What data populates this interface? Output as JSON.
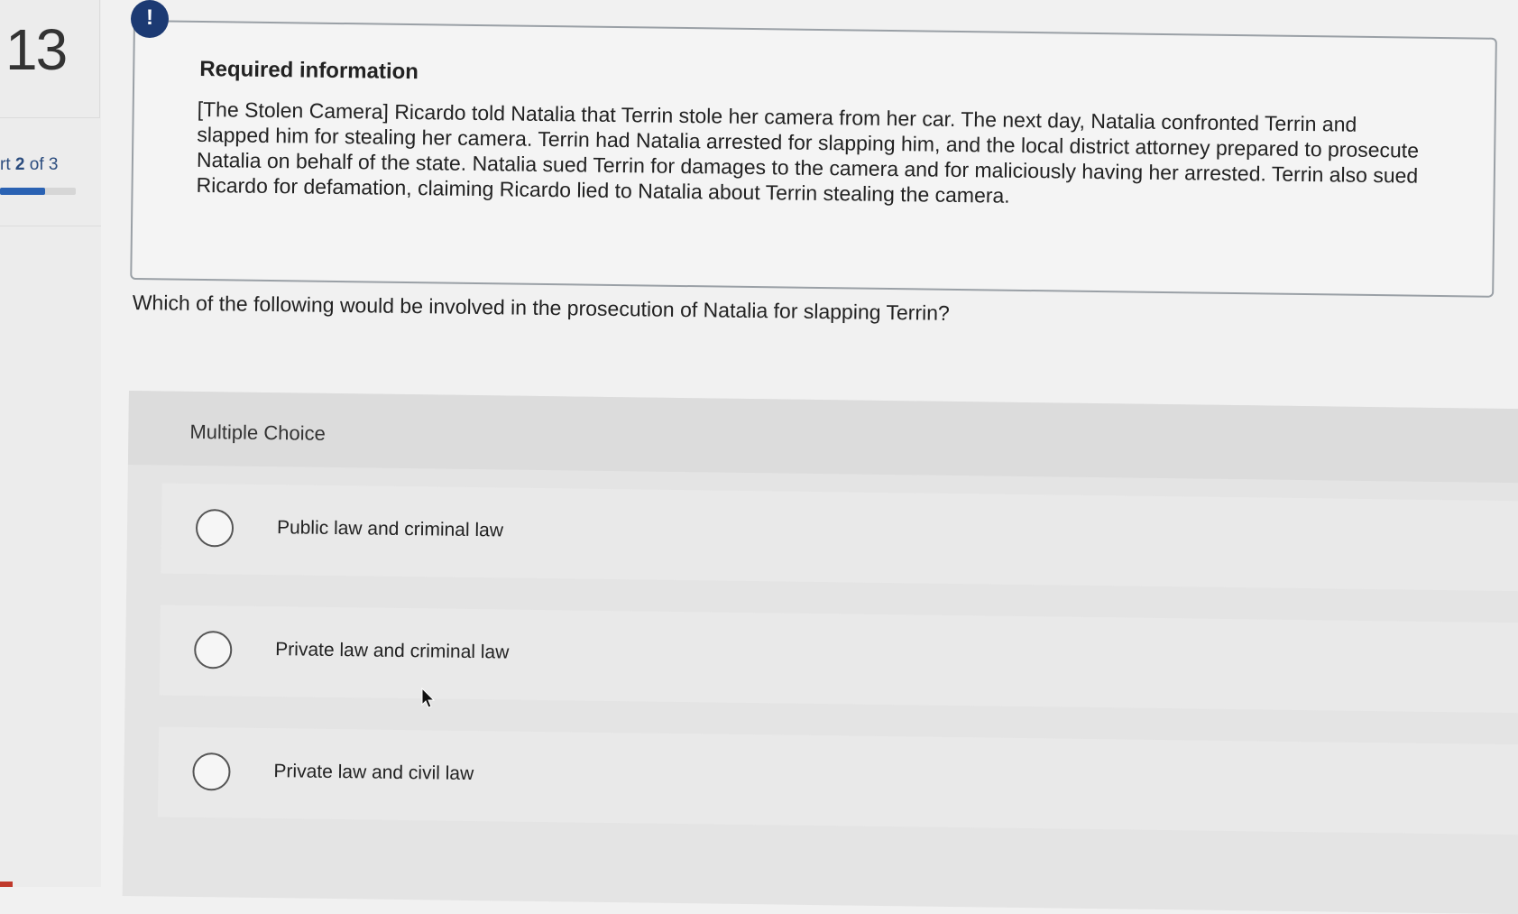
{
  "sidebar": {
    "question_number": "13",
    "part_prefix": "rt ",
    "part_current": "2",
    "part_of": " of 3",
    "progress_fraction": 0.6
  },
  "alert": {
    "icon": "exclamation-icon",
    "glyph": "!"
  },
  "info": {
    "title": "Required information",
    "body": "[The Stolen Camera] Ricardo told Natalia that Terrin stole her camera from her car. The next day, Natalia confronted Terrin and slapped him for stealing her camera. Terrin had Natalia arrested for slapping him, and the local district attorney prepared to prosecute Natalia on behalf of the state. Natalia sued Terrin for damages to the camera and for maliciously having her arrested. Terrin also sued Ricardo for defamation, claiming Ricardo lied to Natalia about Terrin stealing the camera."
  },
  "question": {
    "text": "Which of the following would be involved in the prosecution of Natalia for slapping Terrin?"
  },
  "multiple_choice": {
    "title": "Multiple Choice",
    "options": [
      {
        "label": "Public law and criminal law"
      },
      {
        "label": "Private law and criminal law"
      },
      {
        "label": "Private law and civil law"
      }
    ]
  },
  "colors": {
    "accent": "#1c3a73",
    "progress": "#2a62b3",
    "part_text": "#2b4c7e"
  }
}
